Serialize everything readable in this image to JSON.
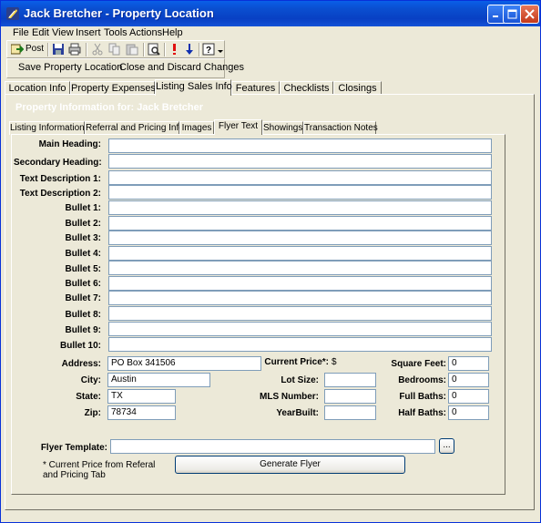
{
  "window": {
    "title": "Jack Bretcher - Property Location",
    "icon": "app-feather-icon",
    "controls": [
      "minimize-icon",
      "maximize-icon",
      "close-icon"
    ]
  },
  "menu": {
    "items": [
      {
        "label": "File"
      },
      {
        "label": "Edit"
      },
      {
        "label": "View"
      },
      {
        "label": "Insert"
      },
      {
        "label": "Tools"
      },
      {
        "label": "Actions"
      },
      {
        "label": "Help"
      }
    ]
  },
  "toolbar": {
    "post_label": "Post",
    "icons": [
      "post-icon",
      "save-icon",
      "print-icon",
      "cut-icon",
      "copy-icon",
      "paste-icon",
      "print-preview-icon",
      "exclamation-icon",
      "down-arrow-icon",
      "help-icon"
    ]
  },
  "command_bar": {
    "save_label": "Save Property Location",
    "close_label": "Close and Discard Changes"
  },
  "main_tabs": [
    {
      "label": "Location Info"
    },
    {
      "label": "Property Expenses"
    },
    {
      "label": "Listing Sales Info"
    },
    {
      "label": "Features"
    },
    {
      "label": "Checklists"
    },
    {
      "label": "Closings"
    }
  ],
  "active_main_tab": "Listing Sales Info",
  "info_header": "Property Information for: Jack Bretcher",
  "sub_tabs": [
    {
      "label": "Listing Information"
    },
    {
      "label": "Referral and Pricing Info"
    },
    {
      "label": "Images"
    },
    {
      "label": "Flyer Text"
    },
    {
      "label": "Showings"
    },
    {
      "label": "Transaction Notes"
    }
  ],
  "active_sub_tab": "Flyer Text",
  "flyer": {
    "main_heading": {
      "label": "Main Heading:",
      "value": ""
    },
    "secondary_heading": {
      "label": "Secondary Heading:",
      "value": ""
    },
    "text_description_1": {
      "label": "Text Description 1:",
      "value": ""
    },
    "text_description_2": {
      "label": "Text Description 2:",
      "value": ""
    },
    "bullets": [
      {
        "label": "Bullet 1:",
        "value": ""
      },
      {
        "label": "Bullet 2:",
        "value": ""
      },
      {
        "label": "Bullet 3:",
        "value": ""
      },
      {
        "label": "Bullet 4:",
        "value": ""
      },
      {
        "label": "Bullet 5:",
        "value": ""
      },
      {
        "label": "Bullet 6:",
        "value": ""
      },
      {
        "label": "Bullet 7:",
        "value": ""
      },
      {
        "label": "Bullet 8:",
        "value": ""
      },
      {
        "label": "Bullet 9:",
        "value": ""
      },
      {
        "label": "Bullet 10:",
        "value": ""
      }
    ]
  },
  "address": {
    "address": {
      "label": "Address:",
      "value": "PO Box 341506"
    },
    "city": {
      "label": "City:",
      "value": "Austin"
    },
    "state": {
      "label": "State:",
      "value": "TX"
    },
    "zip": {
      "label": "Zip:",
      "value": "78734"
    }
  },
  "pricing": {
    "current_price": {
      "label": "Current Price*:",
      "prefix": "$"
    },
    "lot_size": {
      "label": "Lot Size:",
      "value": ""
    },
    "mls_number": {
      "label": "MLS Number:",
      "value": ""
    },
    "year_built": {
      "label": "YearBuilt:",
      "value": ""
    }
  },
  "details": {
    "square_feet": {
      "label": "Square Feet:",
      "value": "0"
    },
    "bedrooms": {
      "label": "Bedrooms:",
      "value": "0"
    },
    "full_baths": {
      "label": "Full Baths:",
      "value": "0"
    },
    "half_baths": {
      "label": "Half Baths:",
      "value": "0"
    }
  },
  "template": {
    "label": "Flyer Template:",
    "value": "",
    "browse_label": "...",
    "note": "* Current Price from Referal and Pricing Tab",
    "generate_label": "Generate Flyer"
  }
}
